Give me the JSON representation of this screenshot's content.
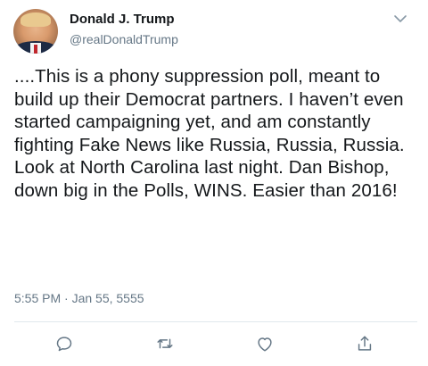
{
  "author": {
    "name": "Donald J. Trump",
    "handle": "@realDonaldTrump"
  },
  "tweet": {
    "text": "....This is a phony suppression poll, meant to build up their Democrat partners. I haven’t even started campaigning yet, and am constantly fighting Fake News like Russia, Russia, Russia. Look at North Carolina last night. Dan Bishop, down big in the Polls, WINS. Easier than 2016!",
    "timestamp": "5:55 PM · Jan 55, 5555"
  },
  "icons": {
    "menu": "chevron-down-icon",
    "reply": "reply-icon",
    "retweet": "retweet-icon",
    "like": "heart-icon",
    "share": "share-icon"
  },
  "colors": {
    "text": "#14171a",
    "secondary": "#657786",
    "divider": "#e1e8ed"
  }
}
